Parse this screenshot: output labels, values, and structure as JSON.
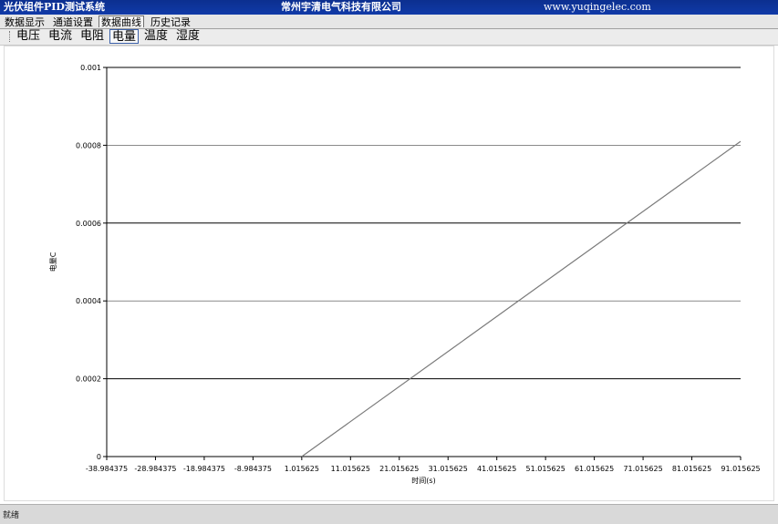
{
  "window": {
    "title": "光伏组件PID测试系统",
    "company": "常州宇清电气科技有限公司",
    "website": "www.yuqingelec.com"
  },
  "main_tabs": [
    {
      "label": "数据显示",
      "active": false
    },
    {
      "label": "通道设置",
      "active": false
    },
    {
      "label": "数据曲线",
      "active": true
    },
    {
      "label": "历史记录",
      "active": false
    }
  ],
  "sub_tabs": [
    {
      "label": "电压",
      "active": false
    },
    {
      "label": "电流",
      "active": false
    },
    {
      "label": "电阻",
      "active": false
    },
    {
      "label": "电量",
      "active": true
    },
    {
      "label": "温度",
      "active": false
    },
    {
      "label": "湿度",
      "active": false
    }
  ],
  "status": {
    "text": "就绪"
  },
  "colors": {
    "title_bar": "#0c2f8f",
    "series": "#7a7a7a",
    "grid": "#000000"
  },
  "chart_data": {
    "type": "line",
    "xlabel": "时间(s)",
    "ylabel": "电量C",
    "x_ticks": [
      "-38.984375",
      "-28.984375",
      "-18.984375",
      "-8.984375",
      "1.015625",
      "11.015625",
      "21.015625",
      "31.015625",
      "41.015625",
      "51.015625",
      "61.015625",
      "71.015625",
      "81.015625",
      "91.015625"
    ],
    "y_ticks": [
      "0",
      "0.0002",
      "0.0004",
      "0.0006",
      "0.0008",
      "0.001"
    ],
    "xlim": [
      -38.984375,
      91.015625
    ],
    "ylim": [
      0,
      0.001
    ],
    "grid": "horizontal",
    "series": [
      {
        "x": [
          1.015625,
          91.015625
        ],
        "y": [
          0,
          0.00081
        ]
      }
    ]
  }
}
